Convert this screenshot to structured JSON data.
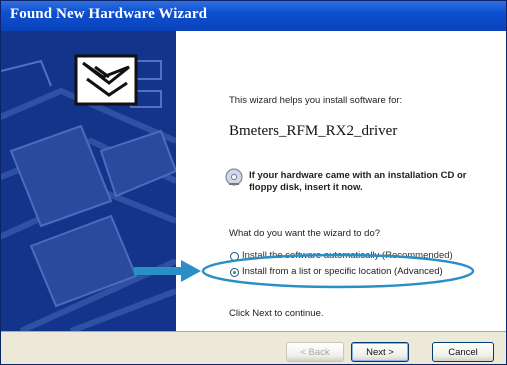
{
  "window": {
    "title": "Found New Hardware Wizard"
  },
  "content": {
    "intro": "This wizard helps you install software for:",
    "device_name": "Bmeters_RFM_RX2_driver",
    "cd_hint_line1": "If your hardware came with an installation CD or",
    "cd_hint_line2": "floppy disk, insert it now.",
    "question": "What do you want the wizard to do?",
    "options": [
      {
        "label": "Install the software automatically (Recommended)",
        "selected": false
      },
      {
        "label": "Install from a list or specific location (Advanced)",
        "selected": true
      }
    ],
    "continue_hint": "Click Next to continue."
  },
  "buttons": {
    "back": "< Back",
    "next": "Next >",
    "cancel": "Cancel"
  },
  "colors": {
    "title_bar": "#0d4fd0",
    "side_panel": "#13348a",
    "annotation": "#2b8ec5"
  },
  "icons": {
    "wizard_header": "hardware-box-icon",
    "cd": "cd-icon"
  }
}
